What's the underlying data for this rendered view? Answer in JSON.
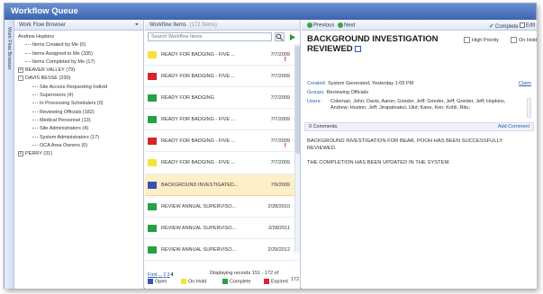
{
  "window": {
    "title": "Workflow Queue"
  },
  "left": {
    "strip_label": "Work Flow Browser",
    "header": "Work Flow Browser",
    "tree": [
      {
        "label": "Andrew Hopkins",
        "depth": 0,
        "toggle": ""
      },
      {
        "label": "Items Created by Me (0)",
        "depth": 1,
        "toggle": ""
      },
      {
        "label": "Items Assigned to Me (335)",
        "depth": 1,
        "toggle": ""
      },
      {
        "label": "Items Completed by Me (17)",
        "depth": 1,
        "toggle": ""
      },
      {
        "label": "BEAVER VALLEY (79)",
        "depth": 0,
        "toggle": "+"
      },
      {
        "label": "DAVIS BESSE (230)",
        "depth": 0,
        "toggle": "-"
      },
      {
        "label": "Site Access Requesting Individ",
        "depth": 2,
        "toggle": ""
      },
      {
        "label": "Supervisors (4)",
        "depth": 2,
        "toggle": ""
      },
      {
        "label": "In Processing Schedulers (0)",
        "depth": 2,
        "toggle": ""
      },
      {
        "label": "Reviewing Officials (182)",
        "depth": 2,
        "toggle": ""
      },
      {
        "label": "Medical Personnel (13)",
        "depth": 2,
        "toggle": ""
      },
      {
        "label": "Site Administrators (4)",
        "depth": 2,
        "toggle": ""
      },
      {
        "label": "System Administrators (17)",
        "depth": 2,
        "toggle": ""
      },
      {
        "label": "OCA Area Owners (0)",
        "depth": 2,
        "toggle": ""
      },
      {
        "label": "PERRY (31)",
        "depth": 0,
        "toggle": "+"
      }
    ]
  },
  "middle": {
    "header": "Workflow Items",
    "header_count": "(172 Items)",
    "search_placeholder": "Search Workflow Items",
    "rows": [
      {
        "name": "READY FOR BADGING - FIVE ...",
        "date": "7/7/2009",
        "status": "onhold",
        "flag": true,
        "selected": false
      },
      {
        "name": "READY FOR BADGING - FIVE ...",
        "date": "7/7/2009",
        "status": "expired",
        "flag": false,
        "selected": false
      },
      {
        "name": "READY FOR BADGING",
        "date": "7/7/2009",
        "status": "complete",
        "flag": false,
        "selected": false
      },
      {
        "name": "READY FOR BADGING - FIVE ...",
        "date": "7/7/2009",
        "status": "complete",
        "flag": false,
        "selected": false
      },
      {
        "name": "READY FOR BADGING - FIVE ...",
        "date": "7/7/2009",
        "status": "expired",
        "flag": true,
        "selected": false
      },
      {
        "name": "READY FOR BADGING - FIVE ...",
        "date": "7/7/2009",
        "status": "onhold",
        "flag": false,
        "selected": false
      },
      {
        "name": "BACKGROUND INVESTIGATED...",
        "date": "7/9/2009",
        "status": "open",
        "flag": false,
        "selected": true
      },
      {
        "name": "REVIEW ANNUAL SUPERVISO...",
        "date": "2/28/2010",
        "status": "complete",
        "flag": false,
        "selected": false
      },
      {
        "name": "REVIEW ANNUAL SUPERVISO...",
        "date": "2/28/2011",
        "status": "complete",
        "flag": false,
        "selected": false
      },
      {
        "name": "REVIEW ANNUAL SUPERVISO...",
        "date": "2/29/2012",
        "status": "complete",
        "flag": false,
        "selected": false
      }
    ],
    "pager": {
      "first": "First",
      "ellipsis": "...",
      "pages": [
        "2",
        "3"
      ],
      "current": "4",
      "display_text": "Displaying records 151 - 172 of",
      "display_total": "172"
    },
    "legend": [
      {
        "key": "open",
        "label": "Open"
      },
      {
        "key": "onhold",
        "label": "On Hold"
      },
      {
        "key": "complete",
        "label": "Complete"
      },
      {
        "key": "expired",
        "label": "Expired"
      }
    ]
  },
  "status_colors": {
    "open": "#3a4fb2",
    "onhold": "#f4e43a",
    "complete": "#28a046",
    "expired": "#d8242e"
  },
  "right": {
    "toolbar": {
      "previous": "Previous",
      "next": "Next",
      "complete": "Complete",
      "edit": "Edit"
    },
    "title": "BACKGROUND INVESTIGATION REVIEWED",
    "high_priority": "High Priority",
    "on_hold": "On Hold",
    "created_label": "Created:",
    "created_value": "System Generated, Yesterday 1:05 PM",
    "claim": "Claim",
    "groups_label": "Groups:",
    "groups_value": "Reviewing Officials",
    "users_label": "Users:",
    "users_value": "Coleman, John; Davis, Aaron; Grieder, Jeff; Grieder, Jeff; Greider, Jeff; Hopkins, Andrew; Huston, Jeff; Jirapatnakul, Ukd; Kane, Ken; Kohli, Ritu;",
    "comments_count": "0 Comments.",
    "add_comment": "Add Comment",
    "body": [
      "BACKGROUND INVESTIGATION FOR BEAR, POOH  HAS BEEN SUCCESSFULLY REVIEWED.",
      "THE COMPLETION HAS BEEN UPDATED IN THE SYSTEM."
    ]
  }
}
